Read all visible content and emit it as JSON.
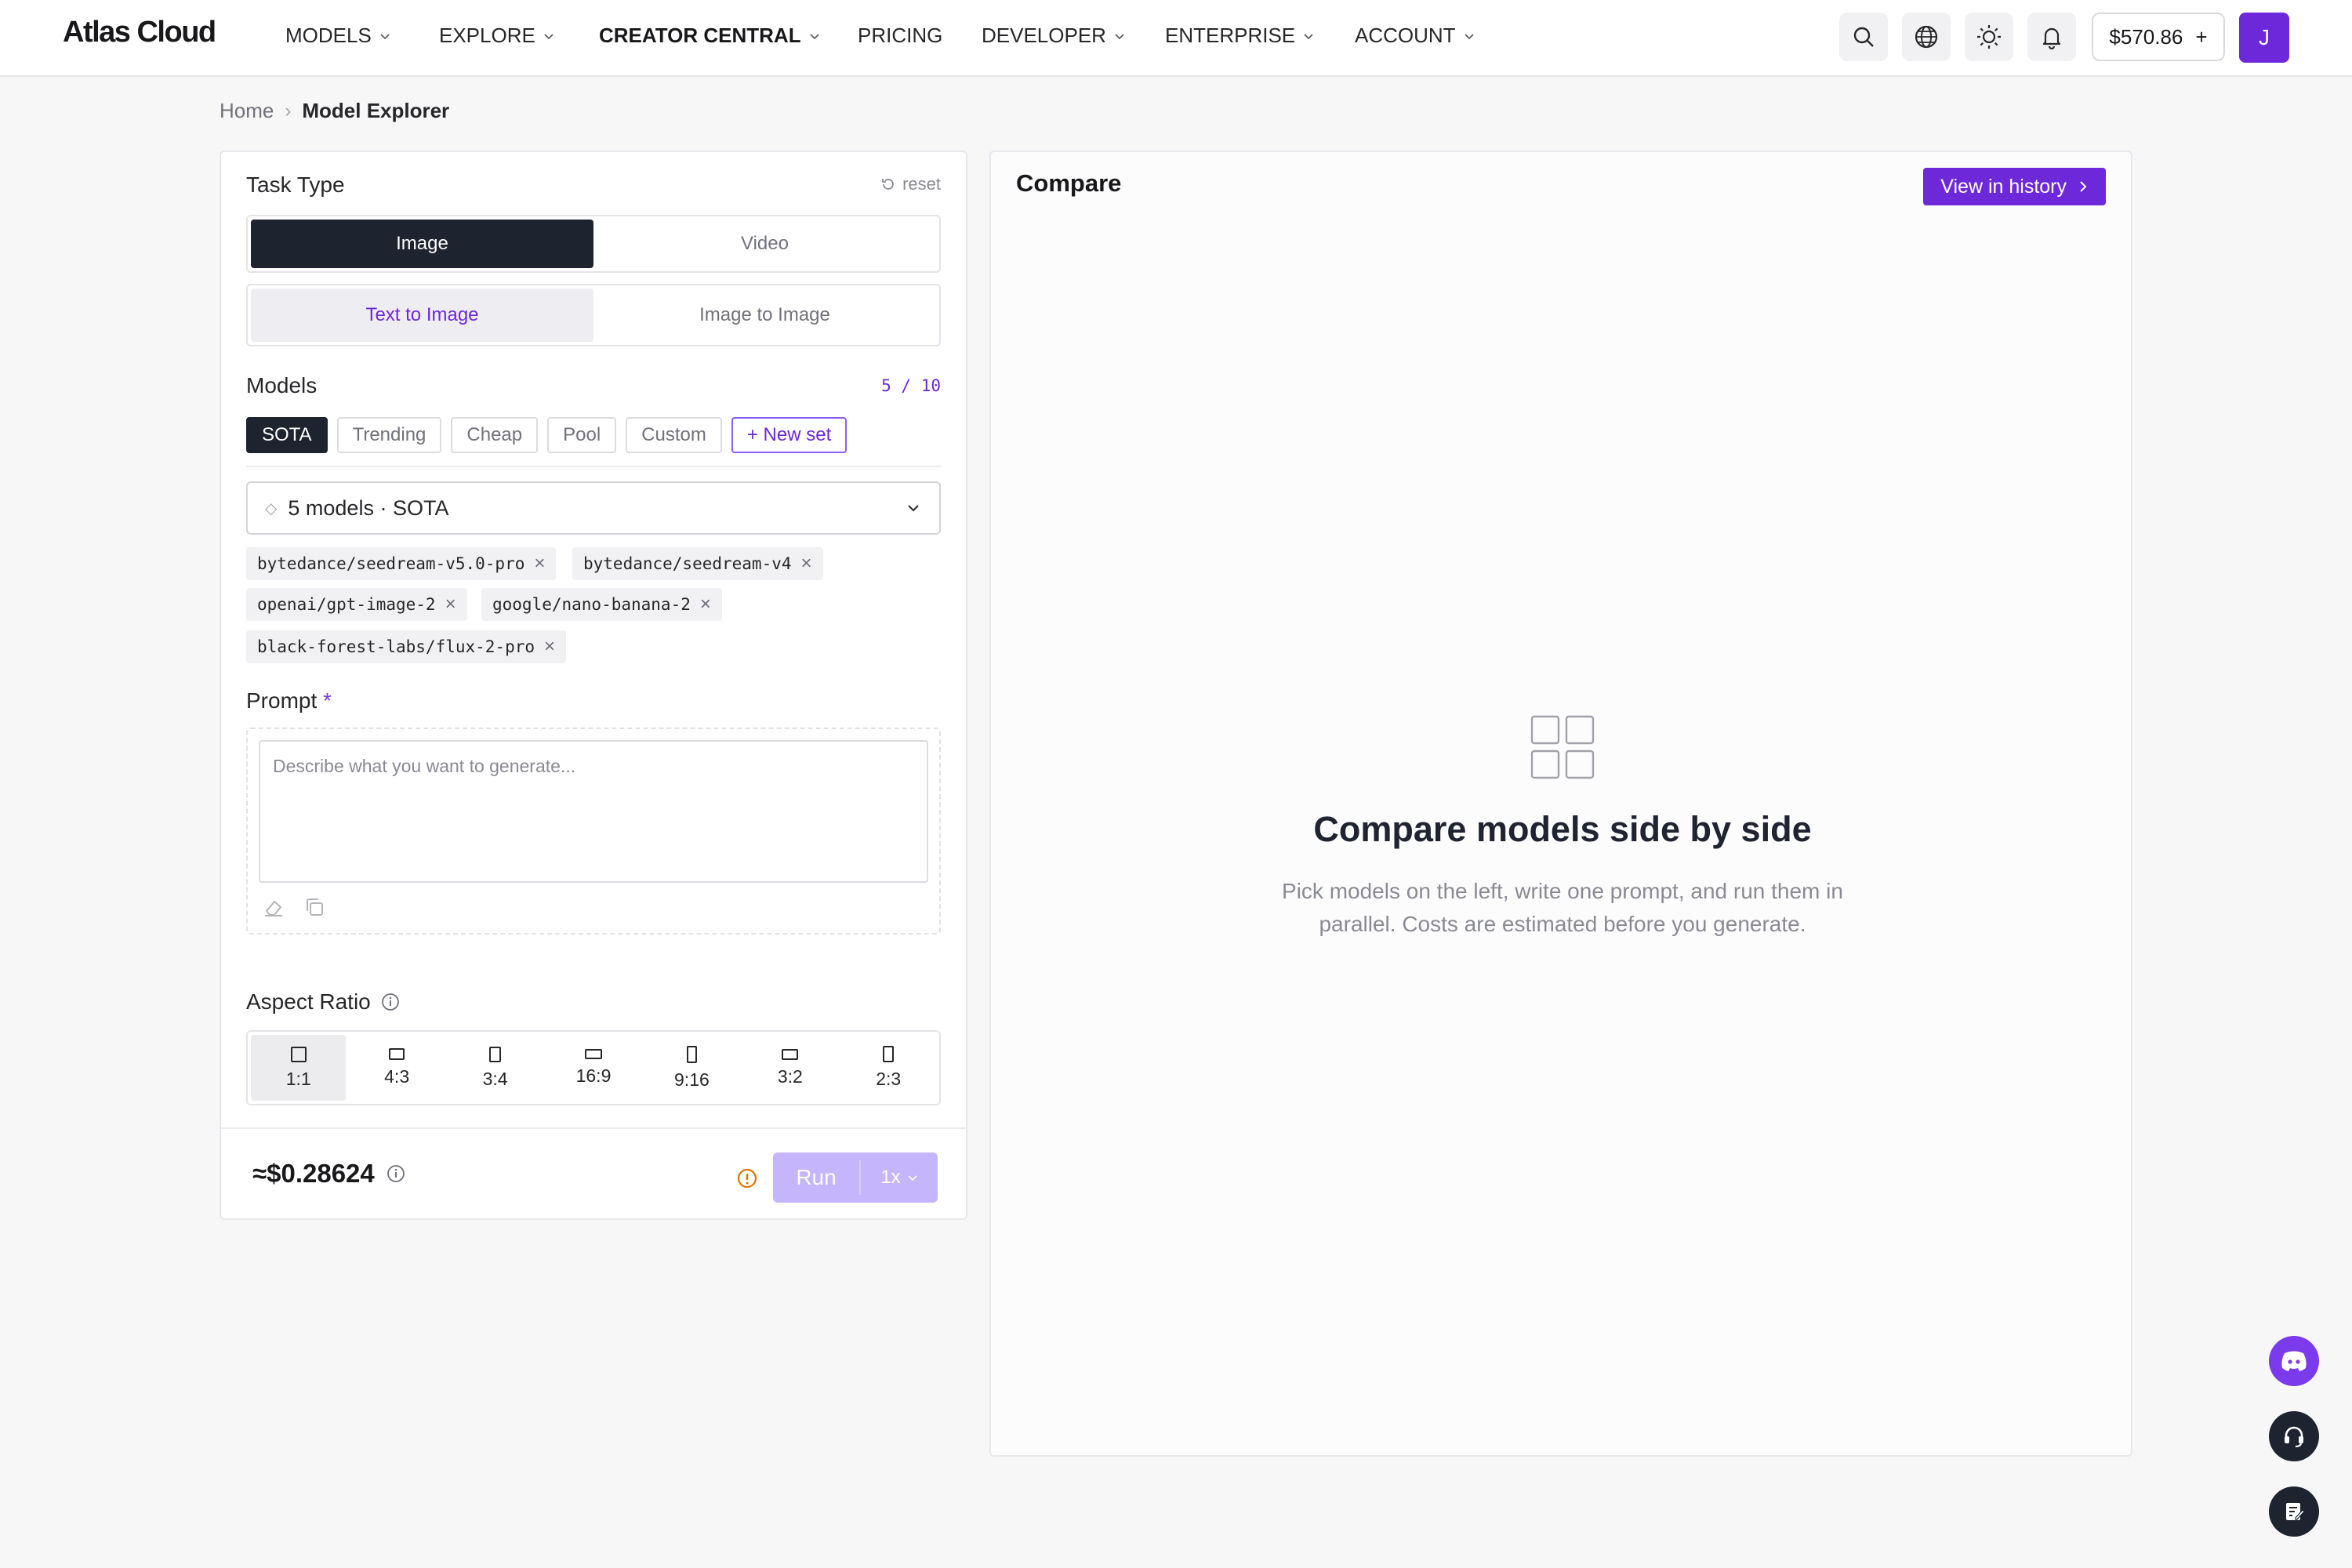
{
  "brand": {
    "logo": "Atlas Cloud",
    "accent": "#6d28d9"
  },
  "nav": {
    "items": [
      {
        "label": "MODELS",
        "dropdown": true
      },
      {
        "label": "EXPLORE",
        "dropdown": true
      },
      {
        "label": "CREATOR CENTRAL",
        "dropdown": true,
        "active": true
      },
      {
        "label": "PRICING",
        "dropdown": false
      },
      {
        "label": "DEVELOPER",
        "dropdown": true
      },
      {
        "label": "ENTERPRISE",
        "dropdown": true
      },
      {
        "label": "ACCOUNT",
        "dropdown": true
      }
    ],
    "icons": [
      "search-icon",
      "globe-icon",
      "sun-icon",
      "bell-icon"
    ],
    "balance": "$570.86",
    "balance_action": "+",
    "avatar_initial": "J"
  },
  "breadcrumb": {
    "home": "Home",
    "separator": "›",
    "current": "Model Explorer"
  },
  "left": {
    "task_type_label": "Task Type",
    "reset_label": "reset",
    "task_types": [
      "Image",
      "Video"
    ],
    "task_type_selected": "Image",
    "modes": [
      "Text to Image",
      "Image to Image"
    ],
    "mode_selected": "Text to Image",
    "models_label": "Models",
    "models_count": "5 / 10",
    "presets": [
      "SOTA",
      "Trending",
      "Cheap",
      "Pool",
      "Custom"
    ],
    "preset_selected": "SOTA",
    "new_set_label": "+ New set",
    "select_value": "5 models · SOTA",
    "selected_models": [
      "bytedance/seedream-v5.0-pro",
      "bytedance/seedream-v4",
      "openai/gpt-image-2",
      "google/nano-banana-2",
      "black-forest-labs/flux-2-pro"
    ],
    "prompt_label": "Prompt",
    "prompt_required": "*",
    "prompt_placeholder": "Describe what you want to generate...",
    "aspect_label": "Aspect Ratio",
    "aspect_ratios": [
      "1:1",
      "4:3",
      "3:4",
      "16:9",
      "9:16",
      "3:2",
      "2:3"
    ],
    "aspect_selected": "1:1",
    "cost": "≈$0.28624",
    "run_label": "Run",
    "run_multiplier": "1x"
  },
  "right": {
    "title": "Compare",
    "history_button": "View in history",
    "empty_title": "Compare models side by side",
    "empty_subtitle": "Pick models on the left, write one prompt, and run them in parallel. Costs are estimated before you generate."
  },
  "floating": [
    "discord-icon",
    "headset-icon",
    "notes-icon"
  ]
}
